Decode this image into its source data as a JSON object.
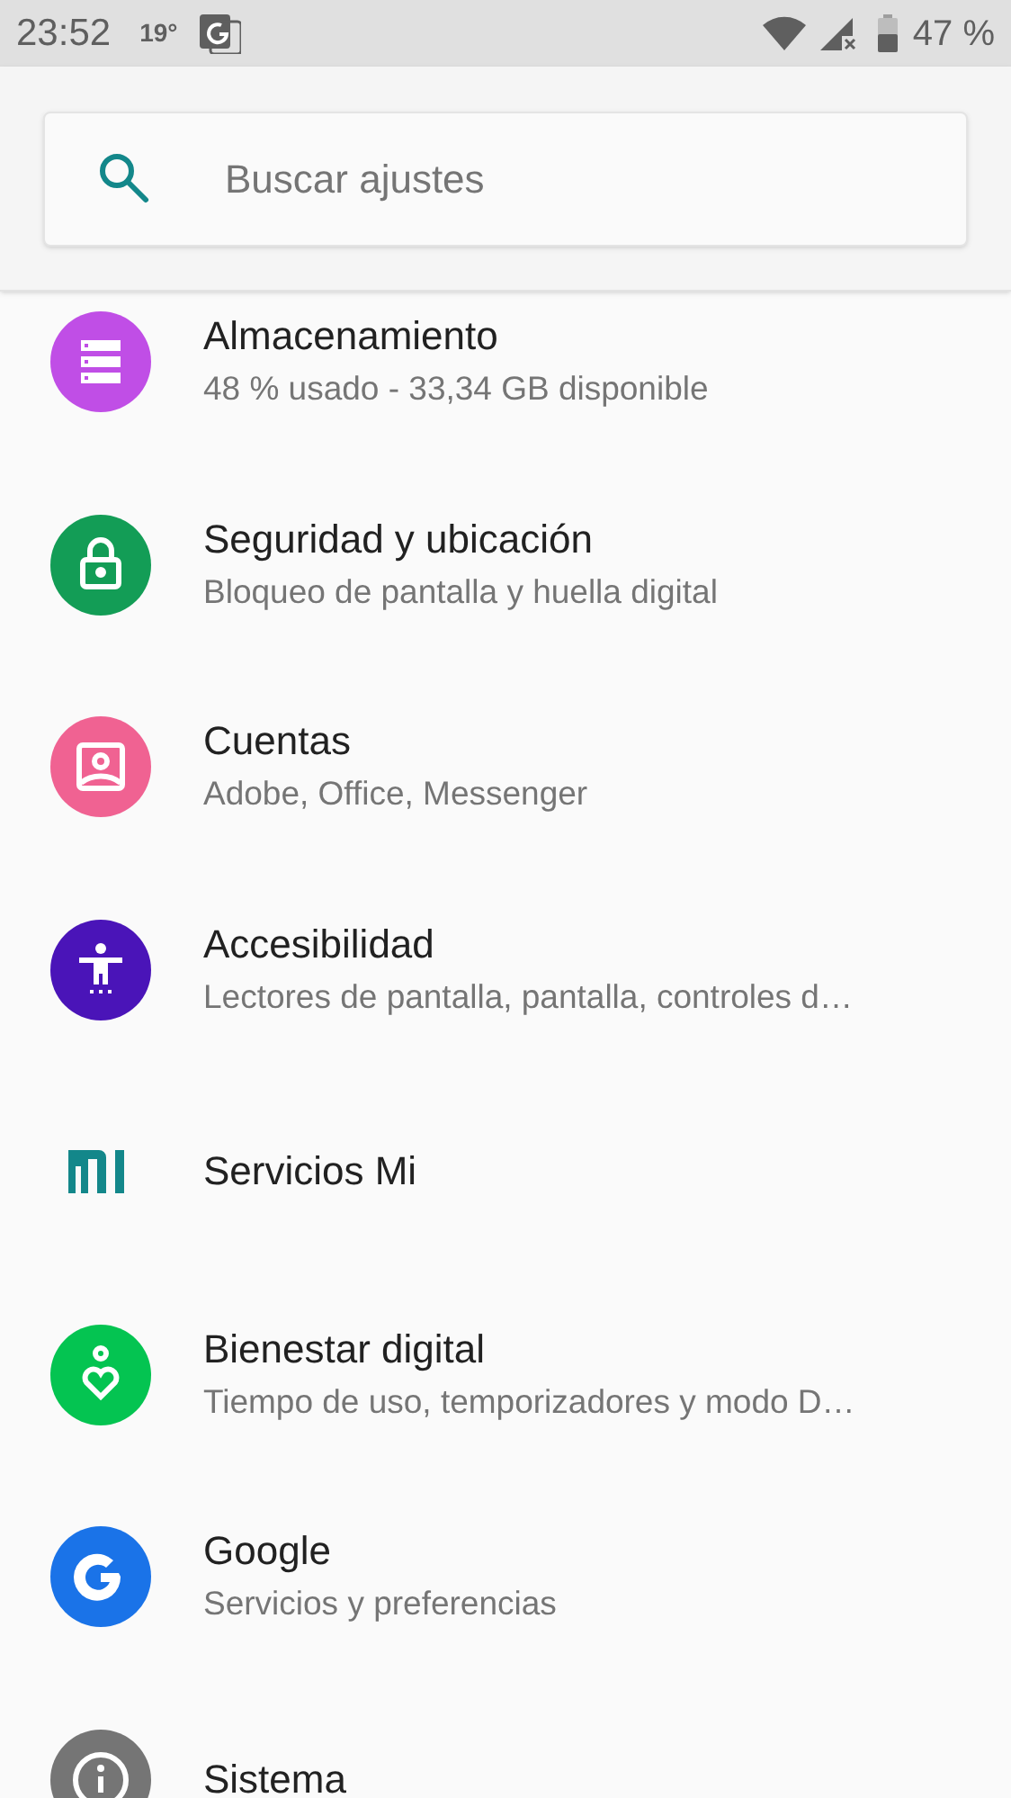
{
  "status_bar": {
    "time": "23:52",
    "temperature": "19°",
    "battery": "47 %"
  },
  "search": {
    "placeholder": "Buscar ajustes"
  },
  "items": [
    {
      "kind": "storage",
      "color": "#c04ee6",
      "title": "Almacenamiento",
      "subtitle": "48 % usado - 33,34 GB disponible"
    },
    {
      "kind": "lock",
      "color": "#139d56",
      "title": "Seguridad y ubicación",
      "subtitle": "Bloqueo de pantalla y huella digital"
    },
    {
      "kind": "account",
      "color": "#f06292",
      "title": "Cuentas",
      "subtitle": "Adobe, Office, Messenger"
    },
    {
      "kind": "accessibility",
      "color": "#4a14b8",
      "title": "Accesibilidad",
      "subtitle": "Lectores de pantalla, pantalla, controles d…"
    },
    {
      "kind": "mi",
      "color": "#13878a",
      "title": "Servicios Mi"
    },
    {
      "kind": "wellbeing",
      "color": "#04c451",
      "title": "Bienestar digital",
      "subtitle": "Tiempo de uso, temporizadores y modo D…"
    },
    {
      "kind": "google",
      "color": "#1a73e8",
      "title": "Google",
      "subtitle": "Servicios y preferencias"
    },
    {
      "kind": "info",
      "color": "#757575",
      "title": "Sistema"
    }
  ]
}
